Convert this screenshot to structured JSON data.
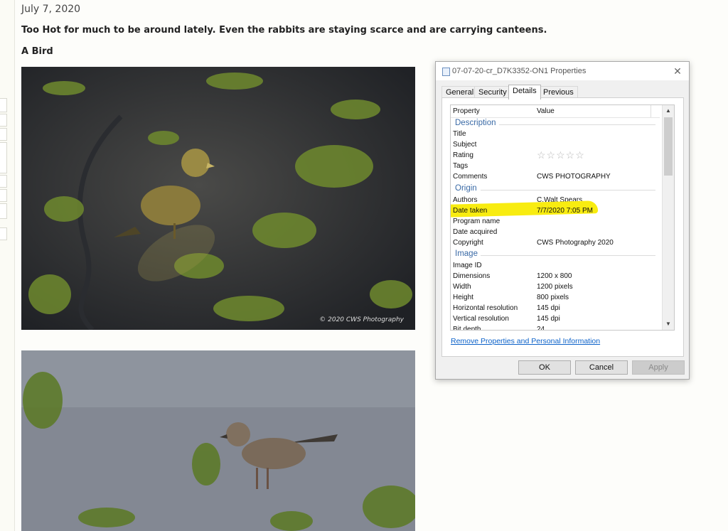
{
  "post": {
    "date": "July 7, 2020",
    "text": "Too Hot for much to be around lately. Even the rabbits are staying scarce and are carrying canteens.",
    "subtitle": "A Bird",
    "photo_watermark": "© 2020  CWS Photography"
  },
  "dialog": {
    "title": "07-07-20-cr_D7K3352-ON1 Properties",
    "close_icon": "close-icon",
    "tabs": [
      "General",
      "Security",
      "Details",
      "Previous Versions"
    ],
    "active_tab": "Details",
    "columns": {
      "property": "Property",
      "value": "Value"
    },
    "sections": {
      "description": "Description",
      "origin": "Origin",
      "image": "Image"
    },
    "description_rows": [
      {
        "key": "Title",
        "value": ""
      },
      {
        "key": "Subject",
        "value": ""
      },
      {
        "key": "Rating",
        "value": ""
      },
      {
        "key": "Tags",
        "value": ""
      },
      {
        "key": "Comments",
        "value": "CWS PHOTOGRAPHY"
      }
    ],
    "rating_stars": "☆☆☆☆☆",
    "origin_rows": [
      {
        "key": "Authors",
        "value": "C.Walt Spears"
      },
      {
        "key": "Date taken",
        "value": "7/7/2020 7:05 PM"
      },
      {
        "key": "Program name",
        "value": ""
      },
      {
        "key": "Date acquired",
        "value": ""
      },
      {
        "key": "Copyright",
        "value": "CWS Photography 2020"
      }
    ],
    "image_rows": [
      {
        "key": "Image ID",
        "value": ""
      },
      {
        "key": "Dimensions",
        "value": "1200 x 800"
      },
      {
        "key": "Width",
        "value": "1200 pixels"
      },
      {
        "key": "Height",
        "value": "800 pixels"
      },
      {
        "key": "Horizontal resolution",
        "value": "145 dpi"
      },
      {
        "key": "Vertical resolution",
        "value": "145 dpi"
      },
      {
        "key": "Bit depth",
        "value": "24"
      }
    ],
    "highlight_color": "#f8ec10",
    "remove_link": "Remove Properties and Personal Information",
    "buttons": {
      "ok": "OK",
      "cancel": "Cancel",
      "apply": "Apply"
    }
  }
}
